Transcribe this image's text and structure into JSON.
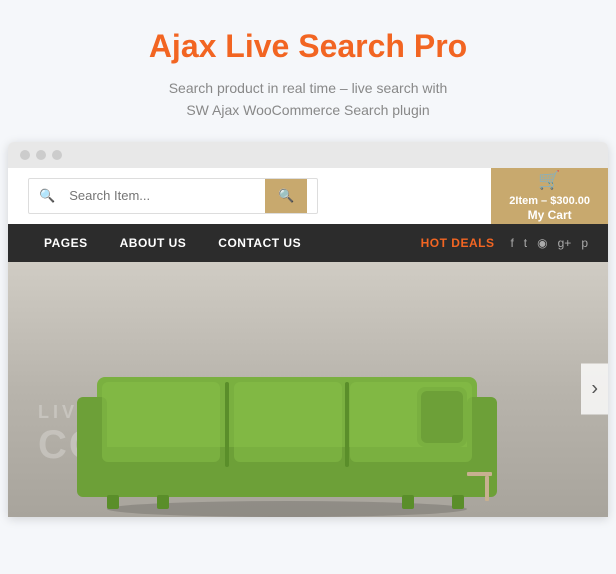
{
  "page": {
    "title": "Ajax Live Search Pro",
    "subtitle_line1": "Search product in real time – live search with",
    "subtitle_line2": "SW Ajax WooCommerce Search plugin"
  },
  "browser": {
    "dots": [
      "dot1",
      "dot2",
      "dot3"
    ]
  },
  "search": {
    "placeholder": "Search Item...",
    "button_label": "🔍"
  },
  "cart": {
    "icon": "🛒",
    "summary": "2Item – $300.00",
    "label": "My Cart"
  },
  "nav": {
    "items": [
      {
        "id": "pages",
        "label": "PAGES",
        "hot": false
      },
      {
        "id": "about",
        "label": "ABOUT US",
        "hot": false
      },
      {
        "id": "contact",
        "label": "CONTACT US",
        "hot": false
      },
      {
        "id": "hotdeals",
        "label": "HOT DEALS",
        "hot": true
      }
    ]
  },
  "social": {
    "icons": [
      {
        "id": "facebook",
        "char": "f"
      },
      {
        "id": "twitter",
        "char": "t"
      },
      {
        "id": "rss",
        "char": "◉"
      },
      {
        "id": "googleplus",
        "char": "g+"
      },
      {
        "id": "pinterest",
        "char": "p"
      }
    ]
  },
  "hero": {
    "watermark_top": "LIVINGROOM",
    "watermark_bottom": "COLLECTION",
    "next_arrow": "›"
  },
  "colors": {
    "orange": "#f26522",
    "gold": "#c8a96e",
    "dark_nav": "#2c2c2c",
    "bg": "#f5f7fa"
  }
}
